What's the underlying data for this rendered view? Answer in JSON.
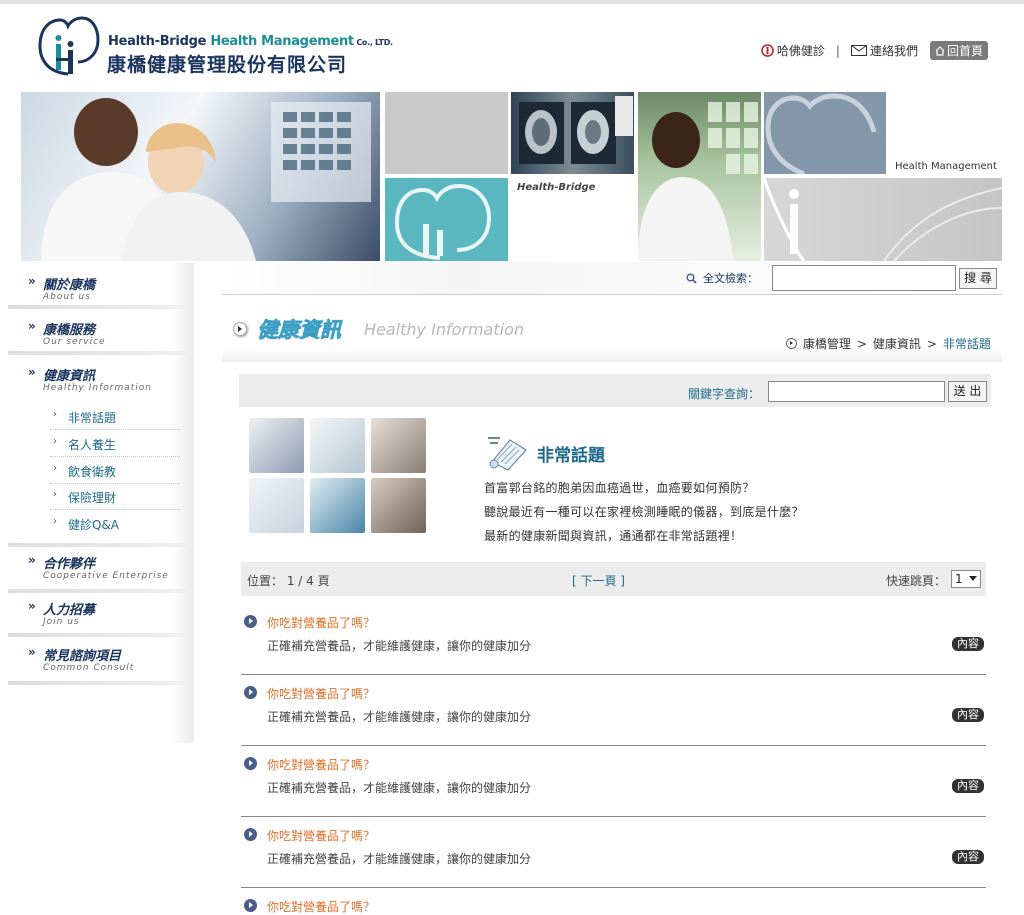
{
  "header": {
    "logo_en_prefix": "Health-Bridge ",
    "logo_en_teal": "Health Management",
    "logo_en_suffix": " Co., LTD.",
    "logo_zh": "康橋健康管理股份有限公司",
    "links": {
      "harvard": "哈佛健診",
      "separator": "|",
      "contact": "連絡我們",
      "home": "回首頁"
    }
  },
  "banner": {
    "tag_health_bridge": "Health-Bridge",
    "tag_health_management": "Health Management"
  },
  "sidebar": {
    "arrow": "»",
    "sections": [
      {
        "title": "關於康橋",
        "subtitle": "About us"
      },
      {
        "title": "康橋服務",
        "subtitle": "Our service"
      },
      {
        "title": "健康資訊",
        "subtitle": "Healthy Information"
      },
      {
        "title": "合作夥伴",
        "subtitle": "Cooperative Enterprise"
      },
      {
        "title": "人力招募",
        "subtitle": "Join us"
      },
      {
        "title": "常見諮詢項目",
        "subtitle": "Common Consult"
      }
    ],
    "sub_items": [
      "非常話題",
      "名人養生",
      "飲食衛教",
      "保險理財",
      "健診Q&A"
    ]
  },
  "search": {
    "label": "全文檢索：",
    "button": "搜 尋"
  },
  "page": {
    "title_zh": "健康資訊",
    "title_en": "Healthy Information",
    "breadcrumb": [
      "康橋管理",
      ">",
      "健康資訊",
      ">",
      "非常話題"
    ]
  },
  "keyword": {
    "label": "關鍵字查詢：",
    "button": "送 出"
  },
  "feature": {
    "title": "非常話題",
    "lines": [
      "首富郭台銘的胞弟因血癌過世，血癌要如何預防？",
      "聽說最近有一種可以在家裡檢測睡眠的儀器，到底是什麼？",
      "最新的健康新聞與資訊，通通都在非常話題裡！"
    ]
  },
  "pager": {
    "position": "位置： 1 / 4 頁",
    "next": "[ 下一頁 ]",
    "jump_label": "快速跳頁：",
    "selected_page": "1"
  },
  "articles": [
    {
      "title": "你吃對營養品了嗎？",
      "desc": "正確補充營養品，才能維護健康，讓你的健康加分",
      "more": "內容"
    },
    {
      "title": "你吃對營養品了嗎？",
      "desc": "正確補充營養品，才能維護健康，讓你的健康加分",
      "more": "內容"
    },
    {
      "title": "你吃對營養品了嗎？",
      "desc": "正確補充營養品，才能維護健康，讓你的健康加分",
      "more": "內容"
    },
    {
      "title": "你吃對營養品了嗎？",
      "desc": "正確補充營養品，才能維護健康，讓你的健康加分",
      "more": "內容"
    },
    {
      "title": "你吃對營養品了嗎？",
      "desc": "",
      "more": ""
    }
  ],
  "colors": {
    "navy": "#1c3560",
    "teal": "#1a8f95",
    "link_blue": "#1e6a8a",
    "article_orange": "#e0702a"
  }
}
